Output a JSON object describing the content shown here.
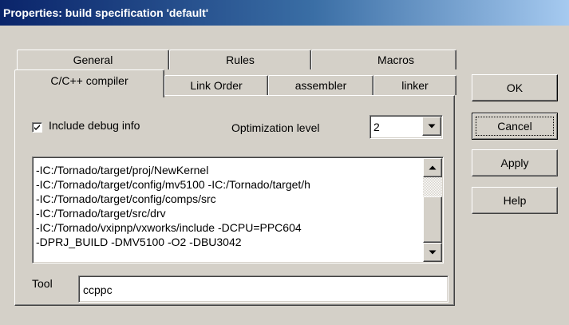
{
  "window": {
    "title": "Properties: build specification 'default'"
  },
  "tabs_back": [
    {
      "label": "General"
    },
    {
      "label": "Rules"
    },
    {
      "label": "Macros"
    }
  ],
  "tabs_front": [
    {
      "label": "C/C++ compiler",
      "selected": true
    },
    {
      "label": "Link Order"
    },
    {
      "label": "assembler"
    },
    {
      "label": "linker"
    }
  ],
  "compiler": {
    "debug_label": "Include debug info",
    "debug_checked": true,
    "optimization_label": "Optimization level",
    "optimization_value": "2",
    "flags": [
      "-IC:/Tornado/target/proj/NewKernel",
      "-IC:/Tornado/target/config/mv5100 -IC:/Tornado/target/h",
      "-IC:/Tornado/target/config/comps/src",
      "-IC:/Tornado/target/src/drv",
      "-IC:/Tornado/vxipnp/vxworks/include -DCPU=PPC604",
      "-DPRJ_BUILD -DMV5100 -O2 -DBU3042"
    ],
    "tool_label": "Tool",
    "tool_value": "ccppc"
  },
  "buttons": {
    "ok": "OK",
    "cancel": "Cancel",
    "apply": "Apply",
    "help": "Help"
  }
}
